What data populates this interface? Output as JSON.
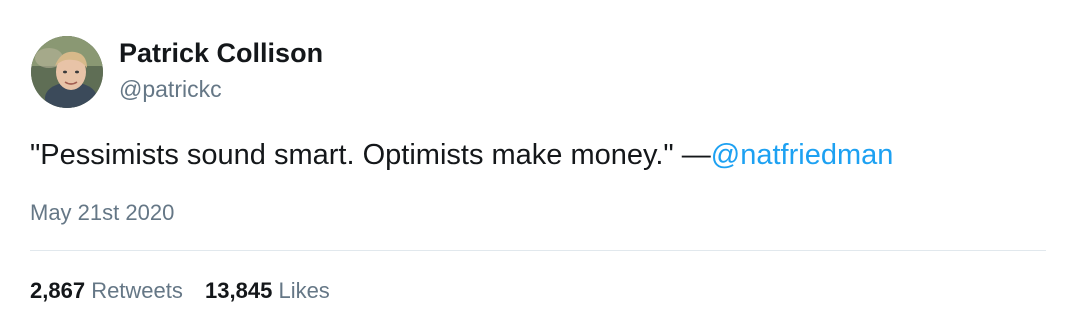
{
  "author": {
    "display_name": "Patrick Collison",
    "handle": "@patrickc"
  },
  "tweet": {
    "text": "\"Pessimists sound smart. Optimists make money.\" —",
    "mention": "@natfriedman",
    "date": "May 21st 2020"
  },
  "stats": {
    "retweets_count": "2,867",
    "retweets_label": "Retweets",
    "likes_count": "13,845",
    "likes_label": "Likes"
  },
  "colors": {
    "text": "#14171a",
    "secondary": "#657786",
    "link": "#1da1f2",
    "divider": "#e1e8ed"
  }
}
